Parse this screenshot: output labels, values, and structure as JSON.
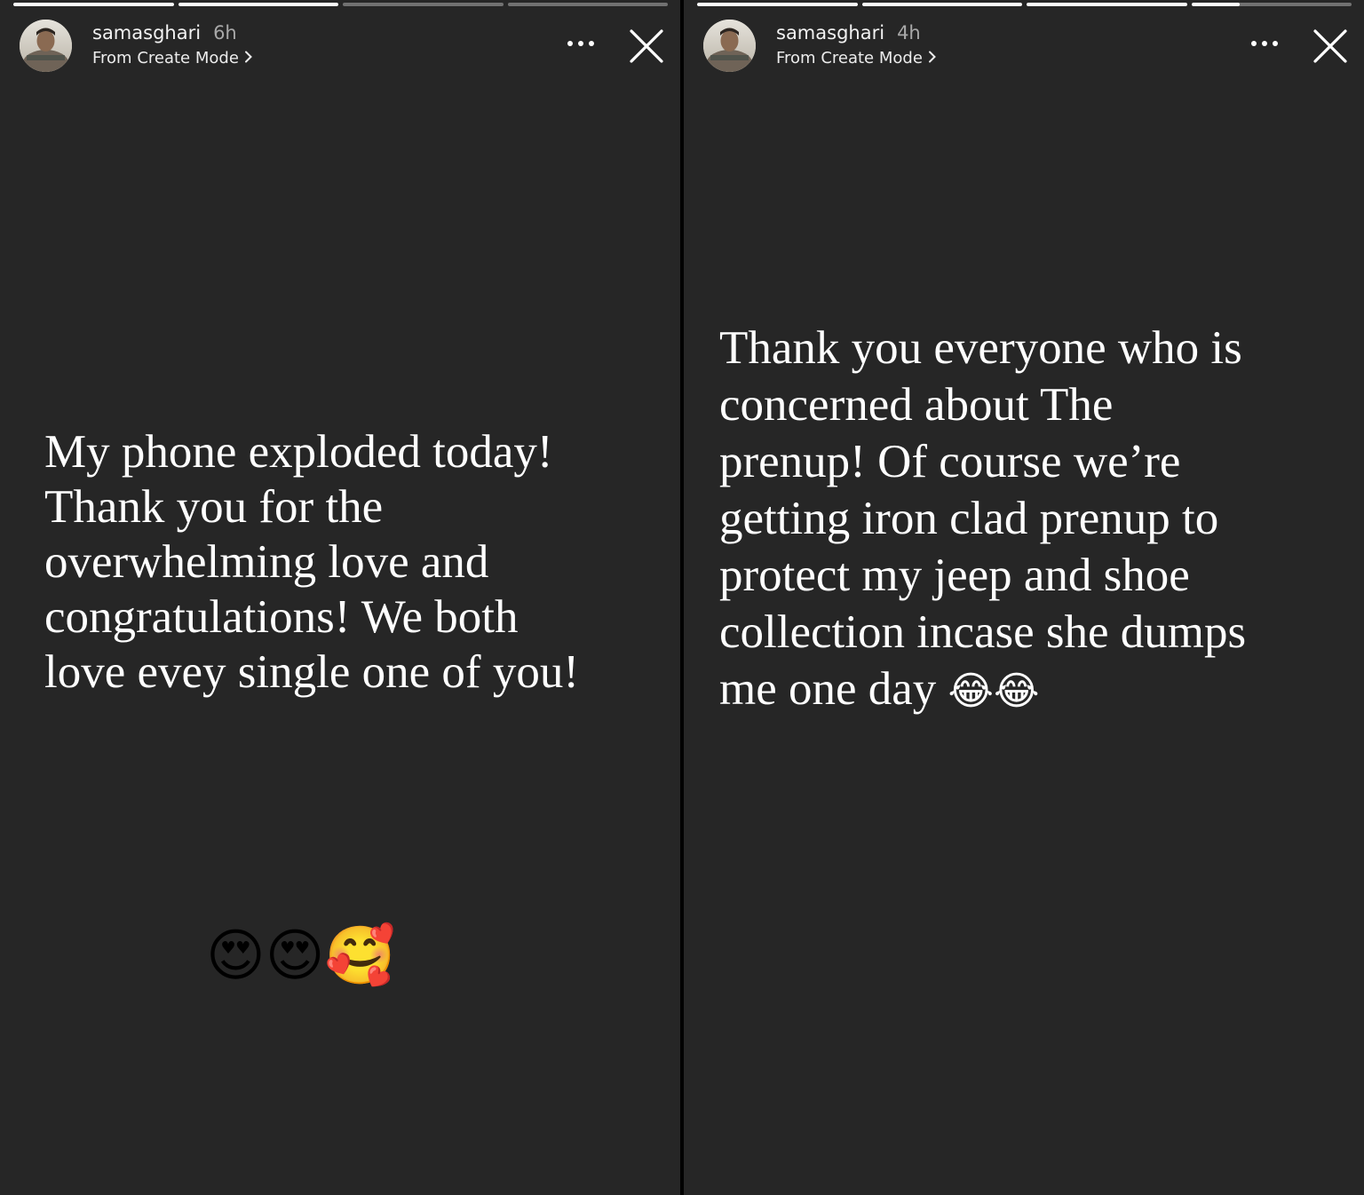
{
  "stories": [
    {
      "username": "samasghari",
      "time": "6h",
      "mode": "From Create Mode",
      "progress": [
        1,
        1,
        0,
        0
      ],
      "text": "My phone exploded today!\nThank you for the\noverwhelming love and\ncongratulations! We both\nlove evey single one of you!",
      "sticker_emojis": "😍😍🥰"
    },
    {
      "username": "samasghari",
      "time": "4h",
      "mode": "From Create Mode",
      "progress": [
        1,
        1,
        1,
        0.3
      ],
      "text": "Thank you everyone who is\nconcerned about The\nprenup! Of course we’re\ngetting iron clad prenup to\nprotect my jeep and shoe\ncollection incase she dumps\nme one day ",
      "inline_emojis": "😂😂"
    }
  ],
  "icons": {
    "more": "more-horizontal-icon",
    "close": "close-icon",
    "chevron": "chevron-right-icon"
  },
  "colors": {
    "story_background": "#262626",
    "text": "#ffffff",
    "secondary_text": "#a8a8a8"
  }
}
